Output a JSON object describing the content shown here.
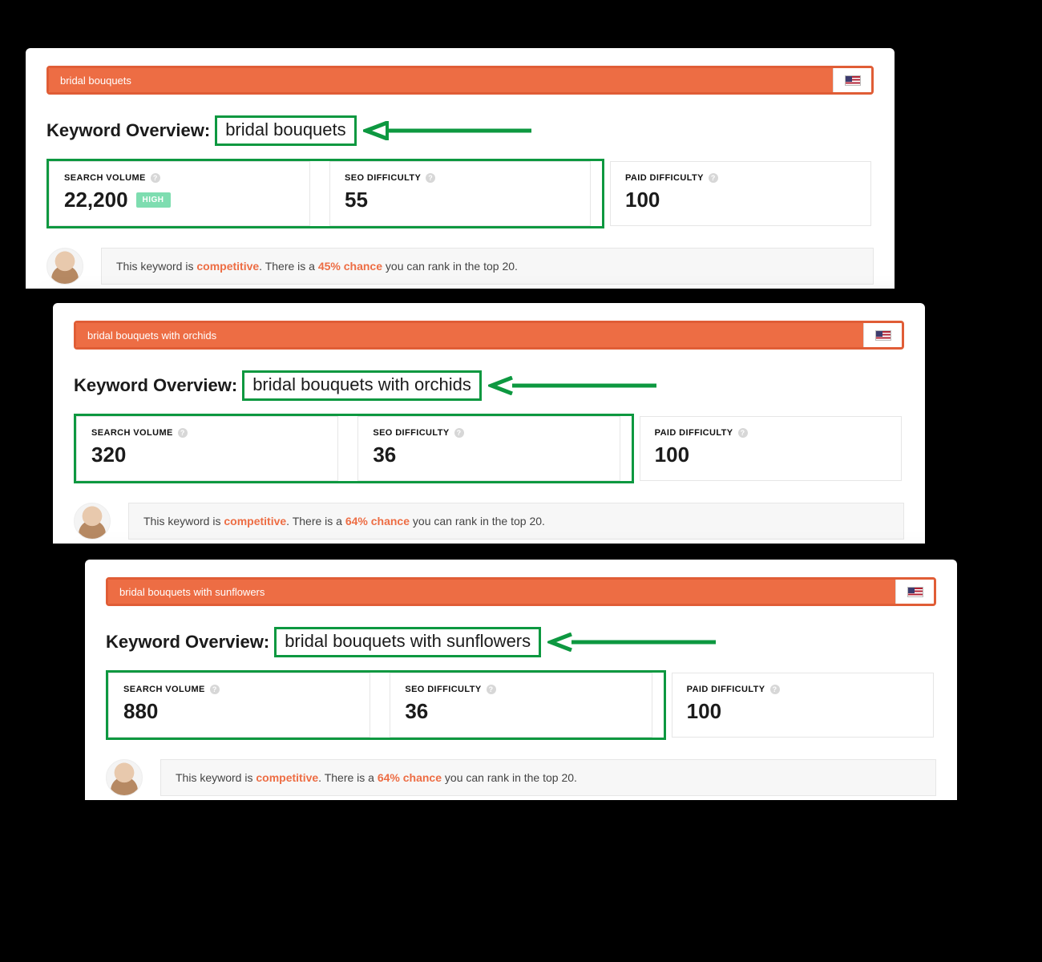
{
  "overview_label": "Keyword Overview:",
  "metric_labels": {
    "search_volume": "SEARCH VOLUME",
    "seo_difficulty": "SEO DIFFICULTY",
    "paid_difficulty": "PAID DIFFICULTY"
  },
  "commentary": {
    "prefix": "This keyword is ",
    "competitive_word": "competitive",
    "mid1": ". There is a ",
    "mid2": " you can rank in the top 20."
  },
  "panels": [
    {
      "query": "bridal bouquets",
      "search_volume": "22,200",
      "volume_badge": "HIGH",
      "seo_difficulty": "55",
      "paid_difficulty": "100",
      "chance": "45% chance"
    },
    {
      "query": "bridal bouquets with orchids",
      "search_volume": "320",
      "volume_badge": "",
      "seo_difficulty": "36",
      "paid_difficulty": "100",
      "chance": "64% chance"
    },
    {
      "query": "bridal bouquets with sunflowers",
      "search_volume": "880",
      "volume_badge": "",
      "seo_difficulty": "36",
      "paid_difficulty": "100",
      "chance": "64% chance"
    }
  ]
}
